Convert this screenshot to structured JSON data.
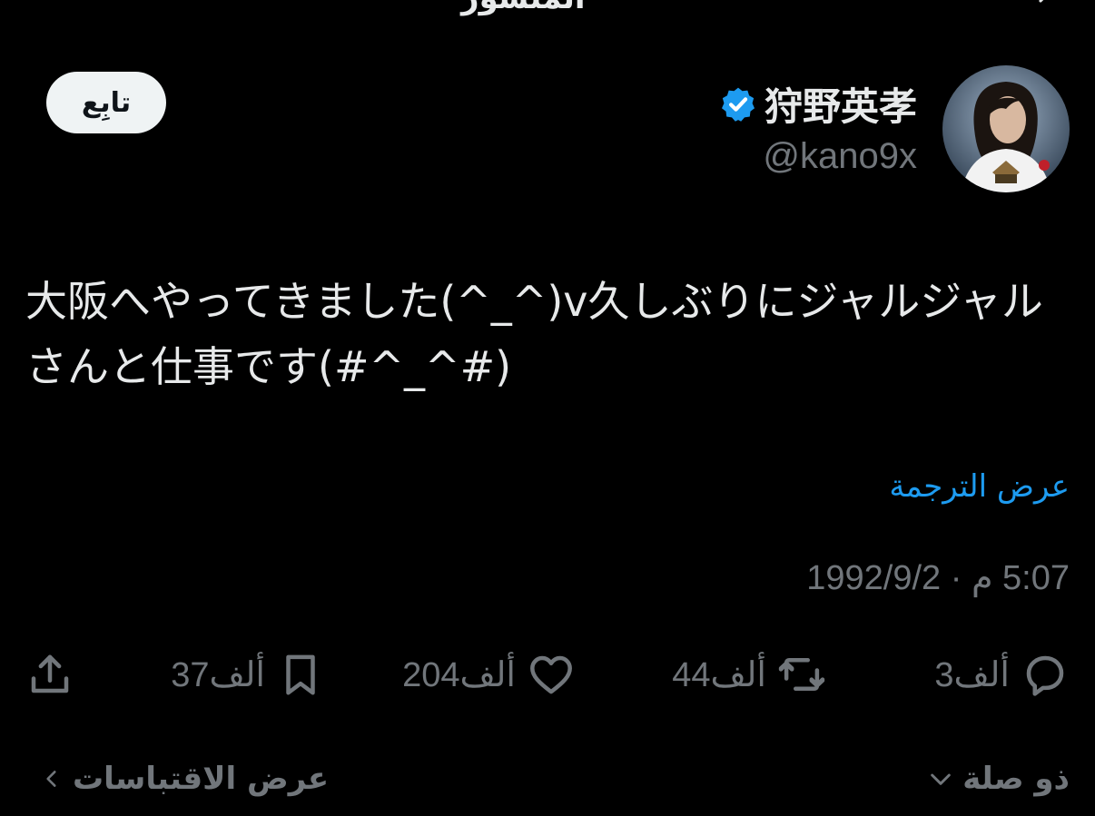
{
  "header": {
    "title": "المنشور"
  },
  "tweet": {
    "display_name": "狩野英孝",
    "handle": "@kano9x",
    "follow_label": "تابِع",
    "text": "大阪へやってきました(^_^)v久しぶりにジャルジャルさんと仕事です(#^_^#)",
    "translate_label": "عرض الترجمة",
    "timestamp": "5:07 م · 1992/9/2"
  },
  "actions": {
    "replies": "3ألف",
    "reposts": "44ألف",
    "likes": "204ألف",
    "bookmarks": "37ألف"
  },
  "footer": {
    "related_label": "ذو صلة",
    "quotes_label": "عرض الاقتباسات"
  },
  "colors": {
    "background": "#000000",
    "text_primary": "#e7e9ea",
    "text_secondary": "#71767b",
    "link": "#1d9bf0",
    "verified": "#1d9bf0",
    "follow_bg": "#eff3f4"
  }
}
